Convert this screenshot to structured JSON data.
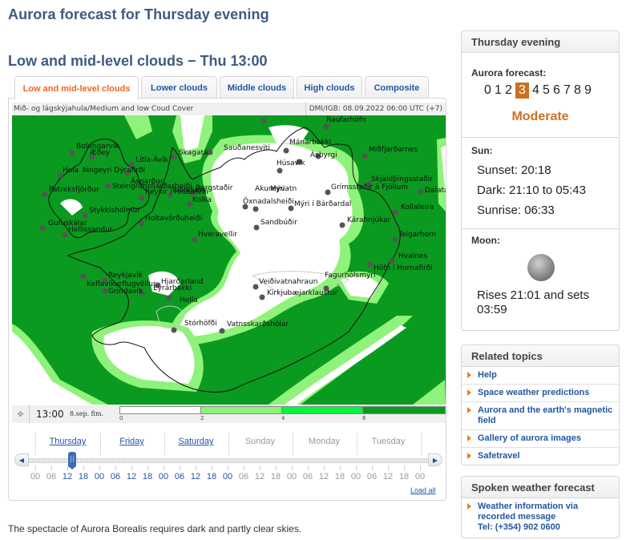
{
  "page": {
    "title": "Aurora forecast for Thursday evening",
    "subtitle": "Low and mid-level clouds − Thu 13:00",
    "footnote": "The spectacle of Aurora Borealis requires dark and partly clear skies."
  },
  "tabs": [
    {
      "label": "Low and mid-level clouds",
      "active": true
    },
    {
      "label": "Lower clouds",
      "active": false
    },
    {
      "label": "Middle clouds",
      "active": false
    },
    {
      "label": "High clouds",
      "active": false
    },
    {
      "label": "Composite",
      "active": false
    }
  ],
  "map": {
    "header_left": "Mið- og lágskýjahula/Medium and low Coud Cover",
    "header_right": "DMI/IGB: 08.09.2022 06:00 UTC (+7)",
    "time": "13:00",
    "date": "8.sep. fim.",
    "legend": {
      "ticks": [
        "0",
        "2",
        "4",
        "6"
      ],
      "colors": [
        "#ffffff",
        "#8ff27a",
        "#00f53b",
        "#0a9a1f"
      ]
    },
    "towns": [
      "Raufarhöfn",
      "Bolungarvík",
      "Æðey",
      "Litla-Ávík",
      "Skagatá",
      "Sauðanesviti",
      "Mánárbakki",
      "Ásbyrgi",
      "Miðfjarðarnes",
      "Hola",
      "Þingeyri Dýrafirði",
      "Húsavík",
      "Patreksfjörður",
      "Steingrímsfjarðarheiði",
      "Blönduós",
      "Bergstaðir",
      "Akureyri",
      "Mývatn",
      "Grímsstaðir á Fjöllum",
      "Skjaldþingsstaðir",
      "Öxnadalsheiði",
      "Mýri í Bárðardal",
      "Dalatangi",
      "Ásgarður",
      "Reykir í Hrútafirði",
      "Kolka",
      "Stykkishólmur",
      "Kollaleira",
      "Holtavörðuheiði",
      "Gufuskálar",
      "Hellissandur",
      "Hveravellir",
      "Sandbúðir",
      "Kárahnjúkar",
      "Teigarhorn",
      "Hvalnes",
      "Veiðivatnahraun",
      "Höfn í Hornafirði",
      "Reykjavík",
      "Hjarðarland",
      "Keflavíkurflugvöllur",
      "Grindavík",
      "Eyrarbakki",
      "Hella",
      "Fagurhólsmýri",
      "Kirkjubæjarklaustur",
      "Stórhöfði",
      "Vatnsskarðshólar"
    ]
  },
  "timeline": {
    "days": [
      {
        "label": "Thursday",
        "link": true
      },
      {
        "label": "Friday",
        "link": true
      },
      {
        "label": "Saturday",
        "link": true
      },
      {
        "label": "Sunday",
        "link": false
      },
      {
        "label": "Monday",
        "link": false
      },
      {
        "label": "Tuesday",
        "link": false
      }
    ],
    "hours": [
      "00",
      "06",
      "12",
      "18",
      "00",
      "06",
      "12",
      "18",
      "00",
      "06",
      "12",
      "18",
      "00",
      "06",
      "12",
      "18",
      "00",
      "06",
      "12",
      "18",
      "00",
      "06",
      "12",
      "18",
      "00"
    ],
    "selected_hour": "13:00",
    "load_all": "Load all"
  },
  "sidebar": {
    "forecast": {
      "title": "Thursday evening",
      "aurora_label": "Aurora forecast:",
      "kp_values": [
        "0",
        "1",
        "2",
        "3",
        "4",
        "5",
        "6",
        "7",
        "8",
        "9"
      ],
      "kp_selected": 3,
      "level": "Moderate",
      "accent": "#cd6f23",
      "sun_label": "Sun:",
      "sunset": "Sunset: 20:18",
      "dark": "Dark: 21:10 to 05:43",
      "sunrise": "Sunrise: 06:33",
      "moon_label": "Moon:",
      "moon_text": "Rises 21:01 and sets 03:59"
    },
    "related": {
      "title": "Related topics",
      "items": [
        "Help",
        "Space weather predictions",
        "Aurora and the earth's magnetic field",
        "Gallery of aurora images",
        "Safetravel"
      ]
    },
    "spoken": {
      "title": "Spoken weather forecast",
      "line1": "Weather information via",
      "line2": "recorded message",
      "line3": "Tel: (+354) 902 0600"
    }
  }
}
